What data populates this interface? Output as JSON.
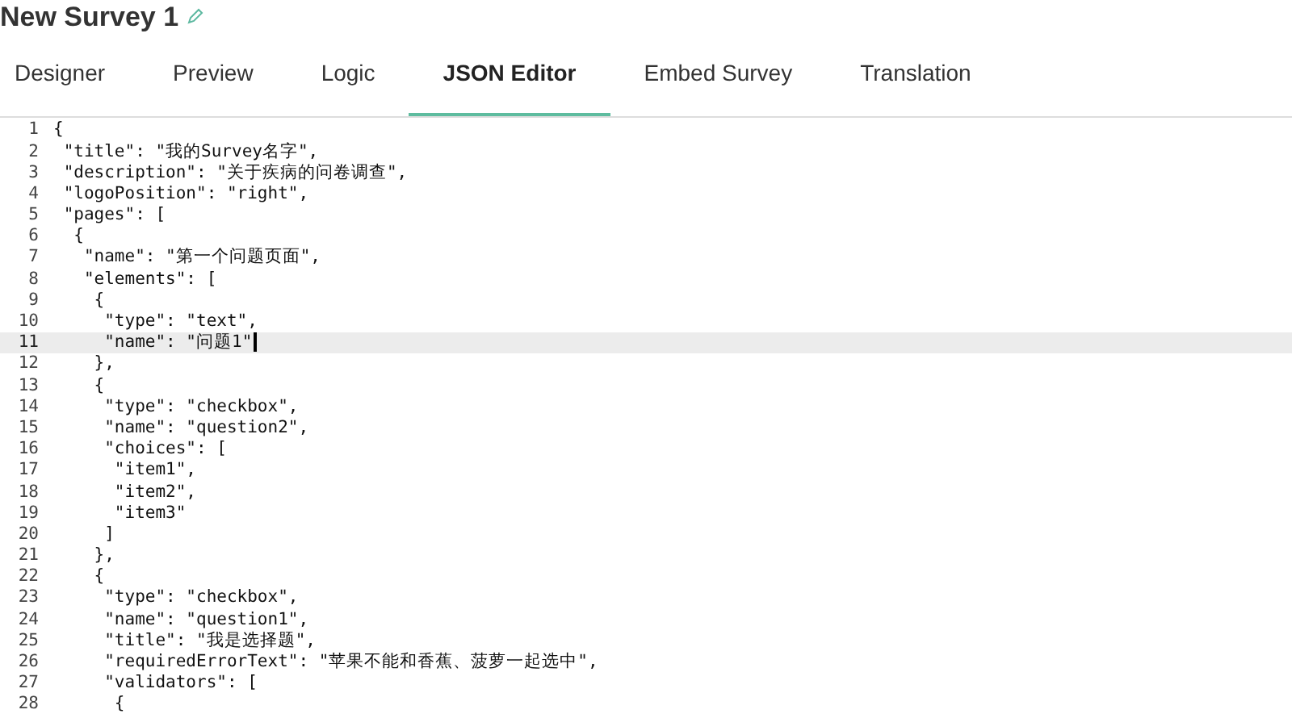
{
  "survey_title": "New Survey 1",
  "tabs": [
    {
      "label": "Designer",
      "selected": false
    },
    {
      "label": "Preview",
      "selected": false
    },
    {
      "label": "Logic",
      "selected": false
    },
    {
      "label": "JSON Editor",
      "selected": true
    },
    {
      "label": "Embed Survey",
      "selected": false
    },
    {
      "label": "Translation",
      "selected": false
    }
  ],
  "editor": {
    "lines": [
      {
        "number": "1",
        "text": "{",
        "current": false
      },
      {
        "number": "2",
        "text": " \"title\": \"我的Survey名字\",",
        "current": false
      },
      {
        "number": "3",
        "text": " \"description\": \"关于疾病的问卷调查\",",
        "current": false
      },
      {
        "number": "4",
        "text": " \"logoPosition\": \"right\",",
        "current": false
      },
      {
        "number": "5",
        "text": " \"pages\": [",
        "current": false
      },
      {
        "number": "6",
        "text": "  {",
        "current": false
      },
      {
        "number": "7",
        "text": "   \"name\": \"第一个问题页面\",",
        "current": false
      },
      {
        "number": "8",
        "text": "   \"elements\": [",
        "current": false
      },
      {
        "number": "9",
        "text": "    {",
        "current": false
      },
      {
        "number": "10",
        "text": "     \"type\": \"text\",",
        "current": false
      },
      {
        "number": "11",
        "text": "     \"name\": \"问题1\"",
        "current": true
      },
      {
        "number": "12",
        "text": "    },",
        "current": false
      },
      {
        "number": "13",
        "text": "    {",
        "current": false
      },
      {
        "number": "14",
        "text": "     \"type\": \"checkbox\",",
        "current": false
      },
      {
        "number": "15",
        "text": "     \"name\": \"question2\",",
        "current": false
      },
      {
        "number": "16",
        "text": "     \"choices\": [",
        "current": false
      },
      {
        "number": "17",
        "text": "      \"item1\",",
        "current": false
      },
      {
        "number": "18",
        "text": "      \"item2\",",
        "current": false
      },
      {
        "number": "19",
        "text": "      \"item3\"",
        "current": false
      },
      {
        "number": "20",
        "text": "     ]",
        "current": false
      },
      {
        "number": "21",
        "text": "    },",
        "current": false
      },
      {
        "number": "22",
        "text": "    {",
        "current": false
      },
      {
        "number": "23",
        "text": "     \"type\": \"checkbox\",",
        "current": false
      },
      {
        "number": "24",
        "text": "     \"name\": \"question1\",",
        "current": false
      },
      {
        "number": "25",
        "text": "     \"title\": \"我是选择题\",",
        "current": false
      },
      {
        "number": "26",
        "text": "     \"requiredErrorText\": \"苹果不能和香蕉、菠萝一起选中\",",
        "current": false
      },
      {
        "number": "27",
        "text": "     \"validators\": [",
        "current": false
      },
      {
        "number": "28",
        "text": "      {",
        "current": false
      }
    ]
  }
}
